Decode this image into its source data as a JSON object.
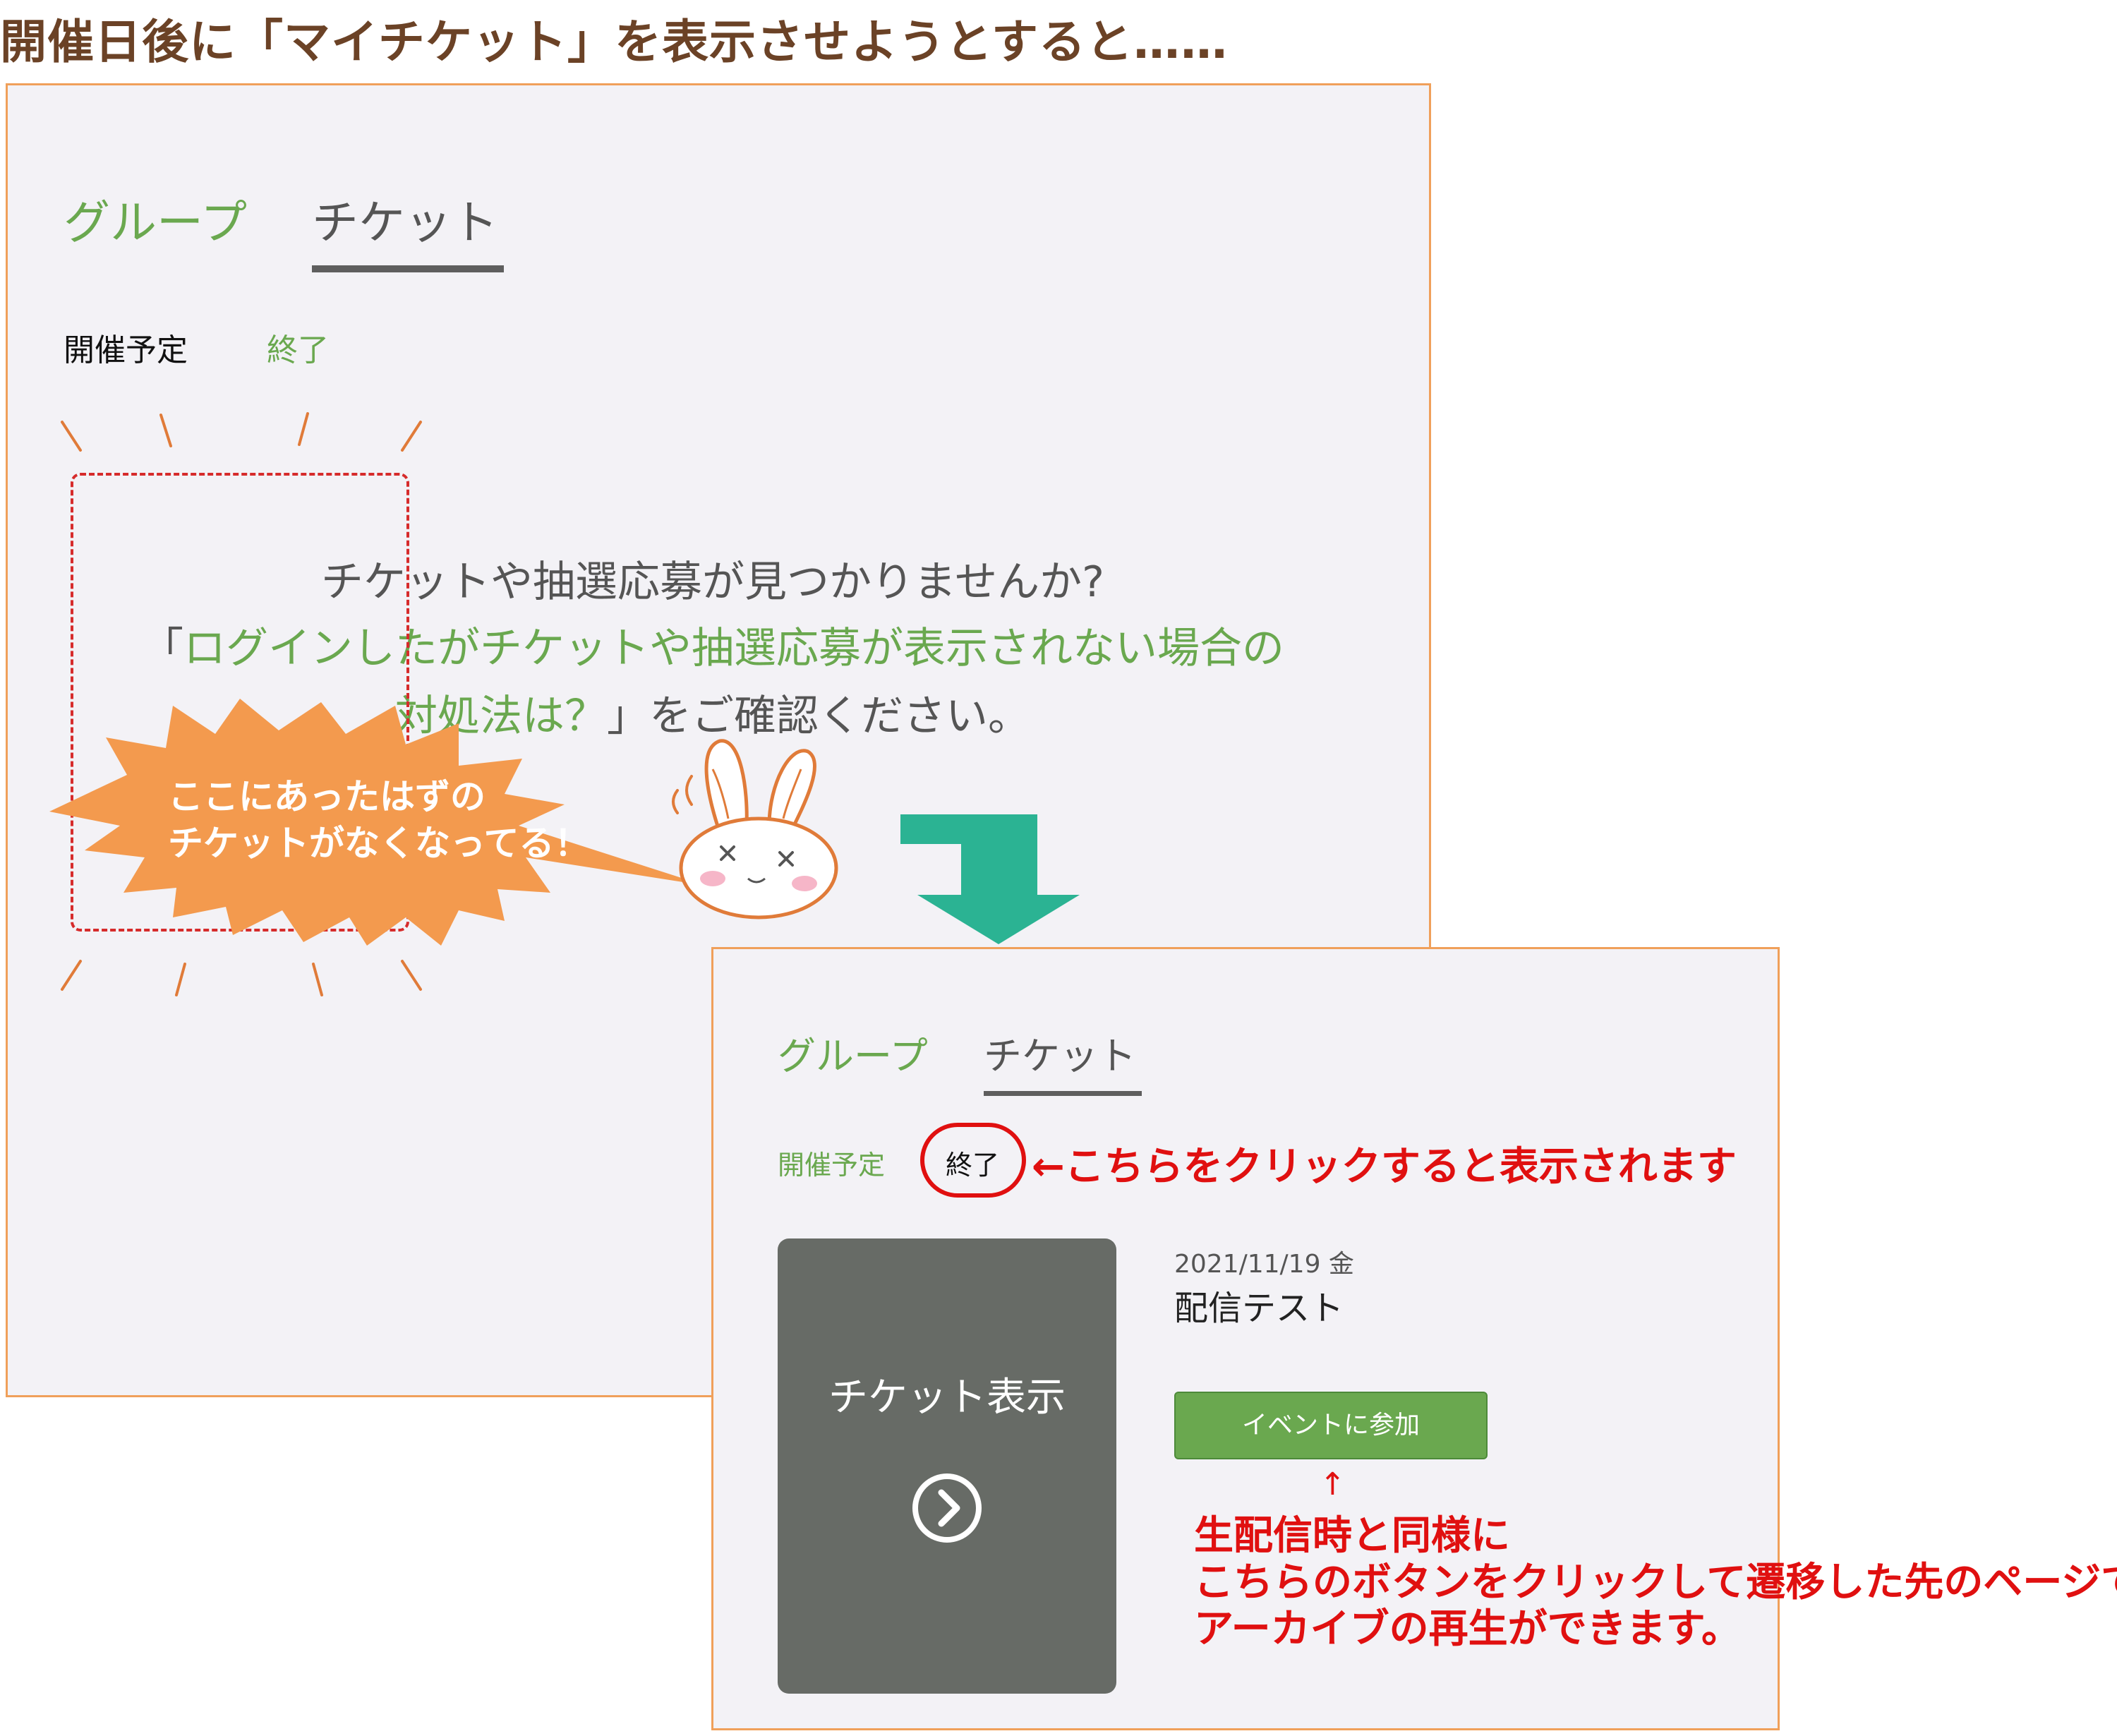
{
  "heading": "開催日後に「マイチケット」を表示させようとすると……",
  "before_panel": {
    "tabs": [
      {
        "label": "グループ",
        "active": false
      },
      {
        "label": "チケット",
        "active": true
      }
    ],
    "filters": [
      {
        "label": "開催予定",
        "active": true
      },
      {
        "label": "終了",
        "active": false
      }
    ],
    "empty_message": {
      "line1": "チケットや抽選応募が見つかりませんか?",
      "line2_open": "「",
      "line2_link": "ログインしたがチケットや抽選応募が表示されない場合の",
      "line3_link": "対処法は？",
      "line3_rest": "」をご確認ください。"
    },
    "callout": {
      "line1": "ここにあったはずの",
      "line2": "チケットがなくなってる！"
    }
  },
  "after_panel": {
    "tabs": [
      {
        "label": "グループ",
        "active": false
      },
      {
        "label": "チケット",
        "active": true
      }
    ],
    "filters": [
      {
        "label": "開催予定",
        "active": false
      },
      {
        "label": "終了",
        "active": true
      }
    ],
    "click_note": "←こちらをクリックすると表示されます",
    "ticket_card": {
      "label": "チケット表示"
    },
    "event": {
      "date": "2021/11/19 金",
      "title": "配信テスト",
      "join_button": "イベントに参加"
    },
    "arrow_glyph": "↑",
    "button_note": {
      "line1": "生配信時と同様に",
      "line2": "こちらのボタンをクリックして遷移した先のページで",
      "line3": "アーカイブの再生ができます。"
    }
  },
  "colors": {
    "accent_green": "#6aa84f",
    "arrow_teal": "#2bb393",
    "annotation_red": "#e01010",
    "heading_brown": "#6b4226",
    "panel_border": "#f0a05a",
    "burst_orange": "#f39a4e"
  }
}
